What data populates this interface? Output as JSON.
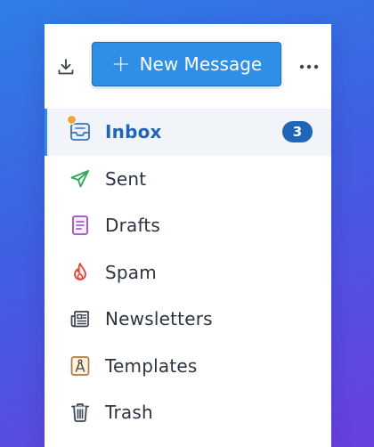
{
  "compose": {
    "label": "New Message",
    "plus": "+"
  },
  "folders": [
    {
      "id": "inbox",
      "label": "Inbox",
      "badge": "3",
      "icon": "inbox-icon",
      "active": true
    },
    {
      "id": "sent",
      "label": "Sent",
      "icon": "send-icon"
    },
    {
      "id": "drafts",
      "label": "Drafts",
      "icon": "draft-document-icon"
    },
    {
      "id": "spam",
      "label": "Spam",
      "icon": "flame-icon"
    },
    {
      "id": "newsletters",
      "label": "Newsletters",
      "icon": "newspaper-icon"
    },
    {
      "id": "templates",
      "label": "Templates",
      "icon": "compass-template-icon"
    },
    {
      "id": "trash",
      "label": "Trash",
      "icon": "trash-icon"
    }
  ],
  "colors": {
    "accent": "#2f8fe6",
    "badge": "#1f66b8",
    "sent": "#2fa85a",
    "drafts": "#9b4fc0",
    "spam": "#d9463a",
    "templates": "#b07a3a",
    "unread_dot": "#f2a43a"
  }
}
